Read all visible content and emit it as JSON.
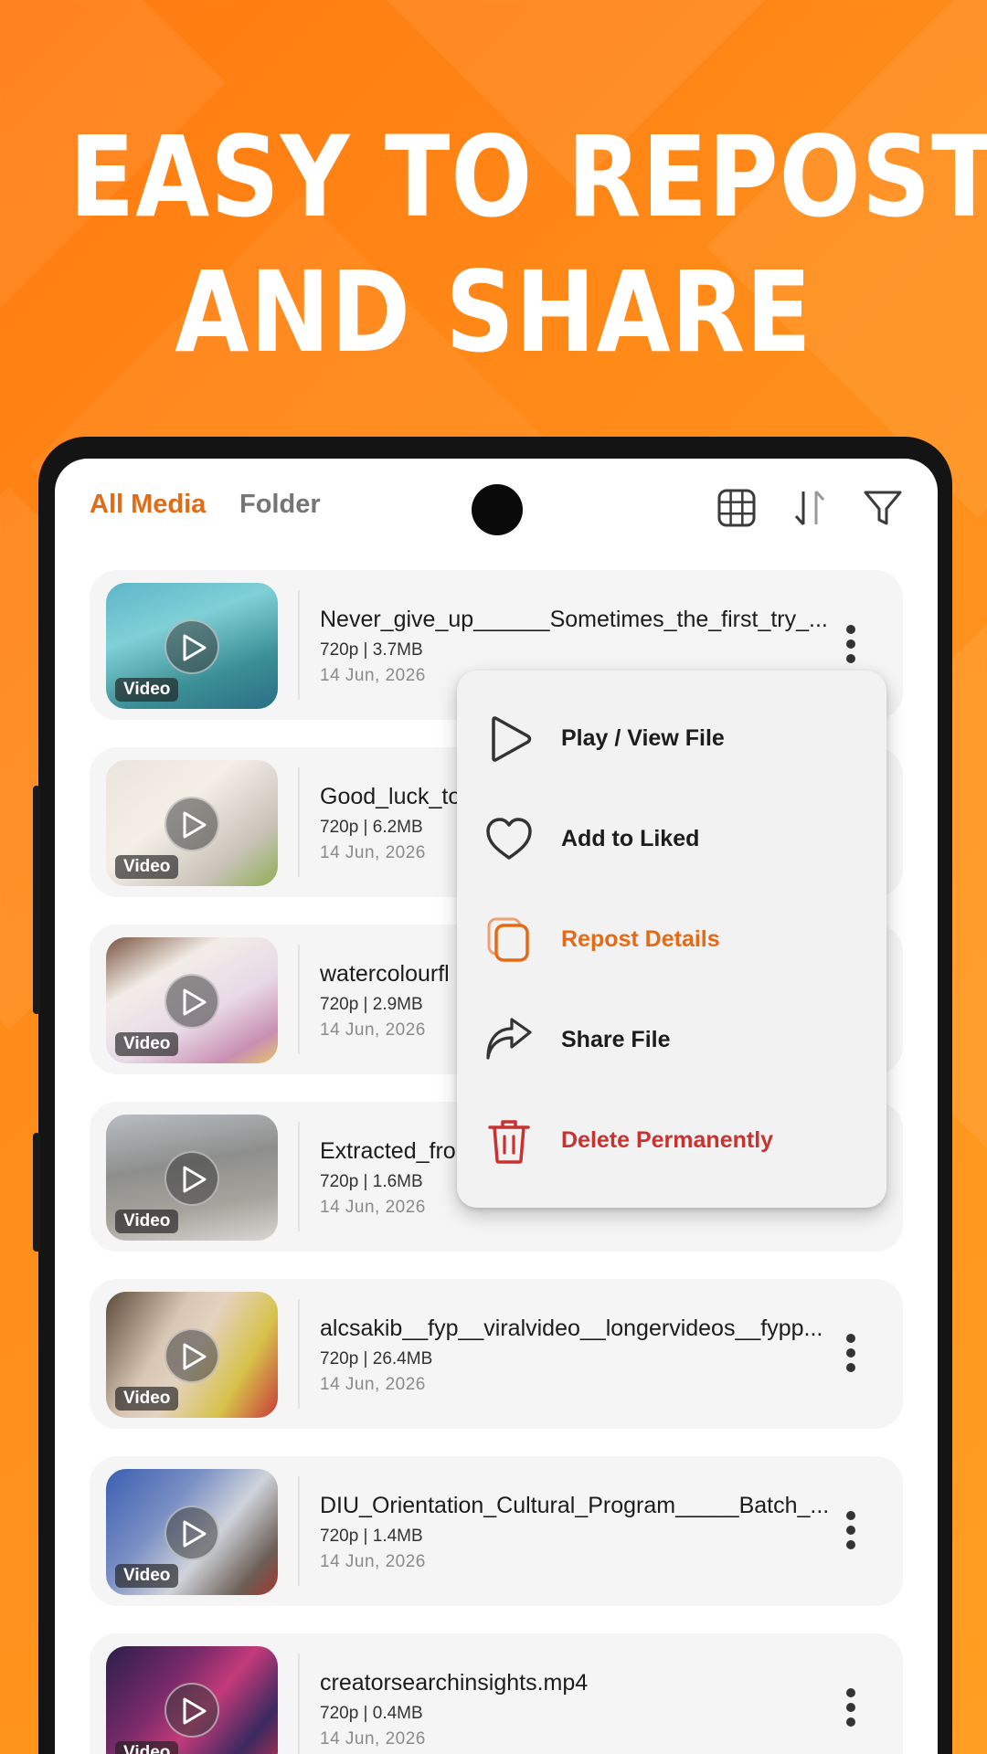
{
  "headline": {
    "line1": "EASY TO REPOST",
    "line2": "AND SHARE"
  },
  "colors": {
    "accent": "#e46a15",
    "danger": "#c8322f",
    "background_orange": "#ff8a18"
  },
  "tabs": {
    "all_media": "All Media",
    "folder": "Folder"
  },
  "toolbar_icons": [
    "grid-view-icon",
    "sort-icon",
    "filter-icon"
  ],
  "media": [
    {
      "title": "Never_give_up______Sometimes_the_first_try_...",
      "meta": "720p | 3.7MB",
      "date": "14 Jun, 2026",
      "badge": "Video"
    },
    {
      "title": "Good_luck_to",
      "meta": "720p | 6.2MB",
      "date": "14 Jun, 2026",
      "badge": "Video"
    },
    {
      "title": "watercolourfl",
      "meta": "720p | 2.9MB",
      "date": "14 Jun, 2026",
      "badge": "Video"
    },
    {
      "title": "Extracted_fro",
      "meta": "720p | 1.6MB",
      "date": "14 Jun, 2026",
      "badge": "Video"
    },
    {
      "title": "alcsakib__fyp__viralvideo__longervideos__fypp...",
      "meta": "720p | 26.4MB",
      "date": "14 Jun, 2026",
      "badge": "Video"
    },
    {
      "title": "DIU_Orientation_Cultural_Program_____Batch_...",
      "meta": "720p | 1.4MB",
      "date": "14 Jun, 2026",
      "badge": "Video"
    },
    {
      "title": "creatorsearchinsights.mp4",
      "meta": "720p | 0.4MB",
      "date": "14 Jun, 2026",
      "badge": "Video"
    }
  ],
  "menu": {
    "items": [
      {
        "label": "Play / View File",
        "icon": "play-icon"
      },
      {
        "label": "Add to Liked",
        "icon": "heart-icon"
      },
      {
        "label": "Repost Details",
        "icon": "repost-icon"
      },
      {
        "label": "Share File",
        "icon": "share-icon"
      },
      {
        "label": "Delete Permanently",
        "icon": "trash-icon"
      }
    ]
  }
}
